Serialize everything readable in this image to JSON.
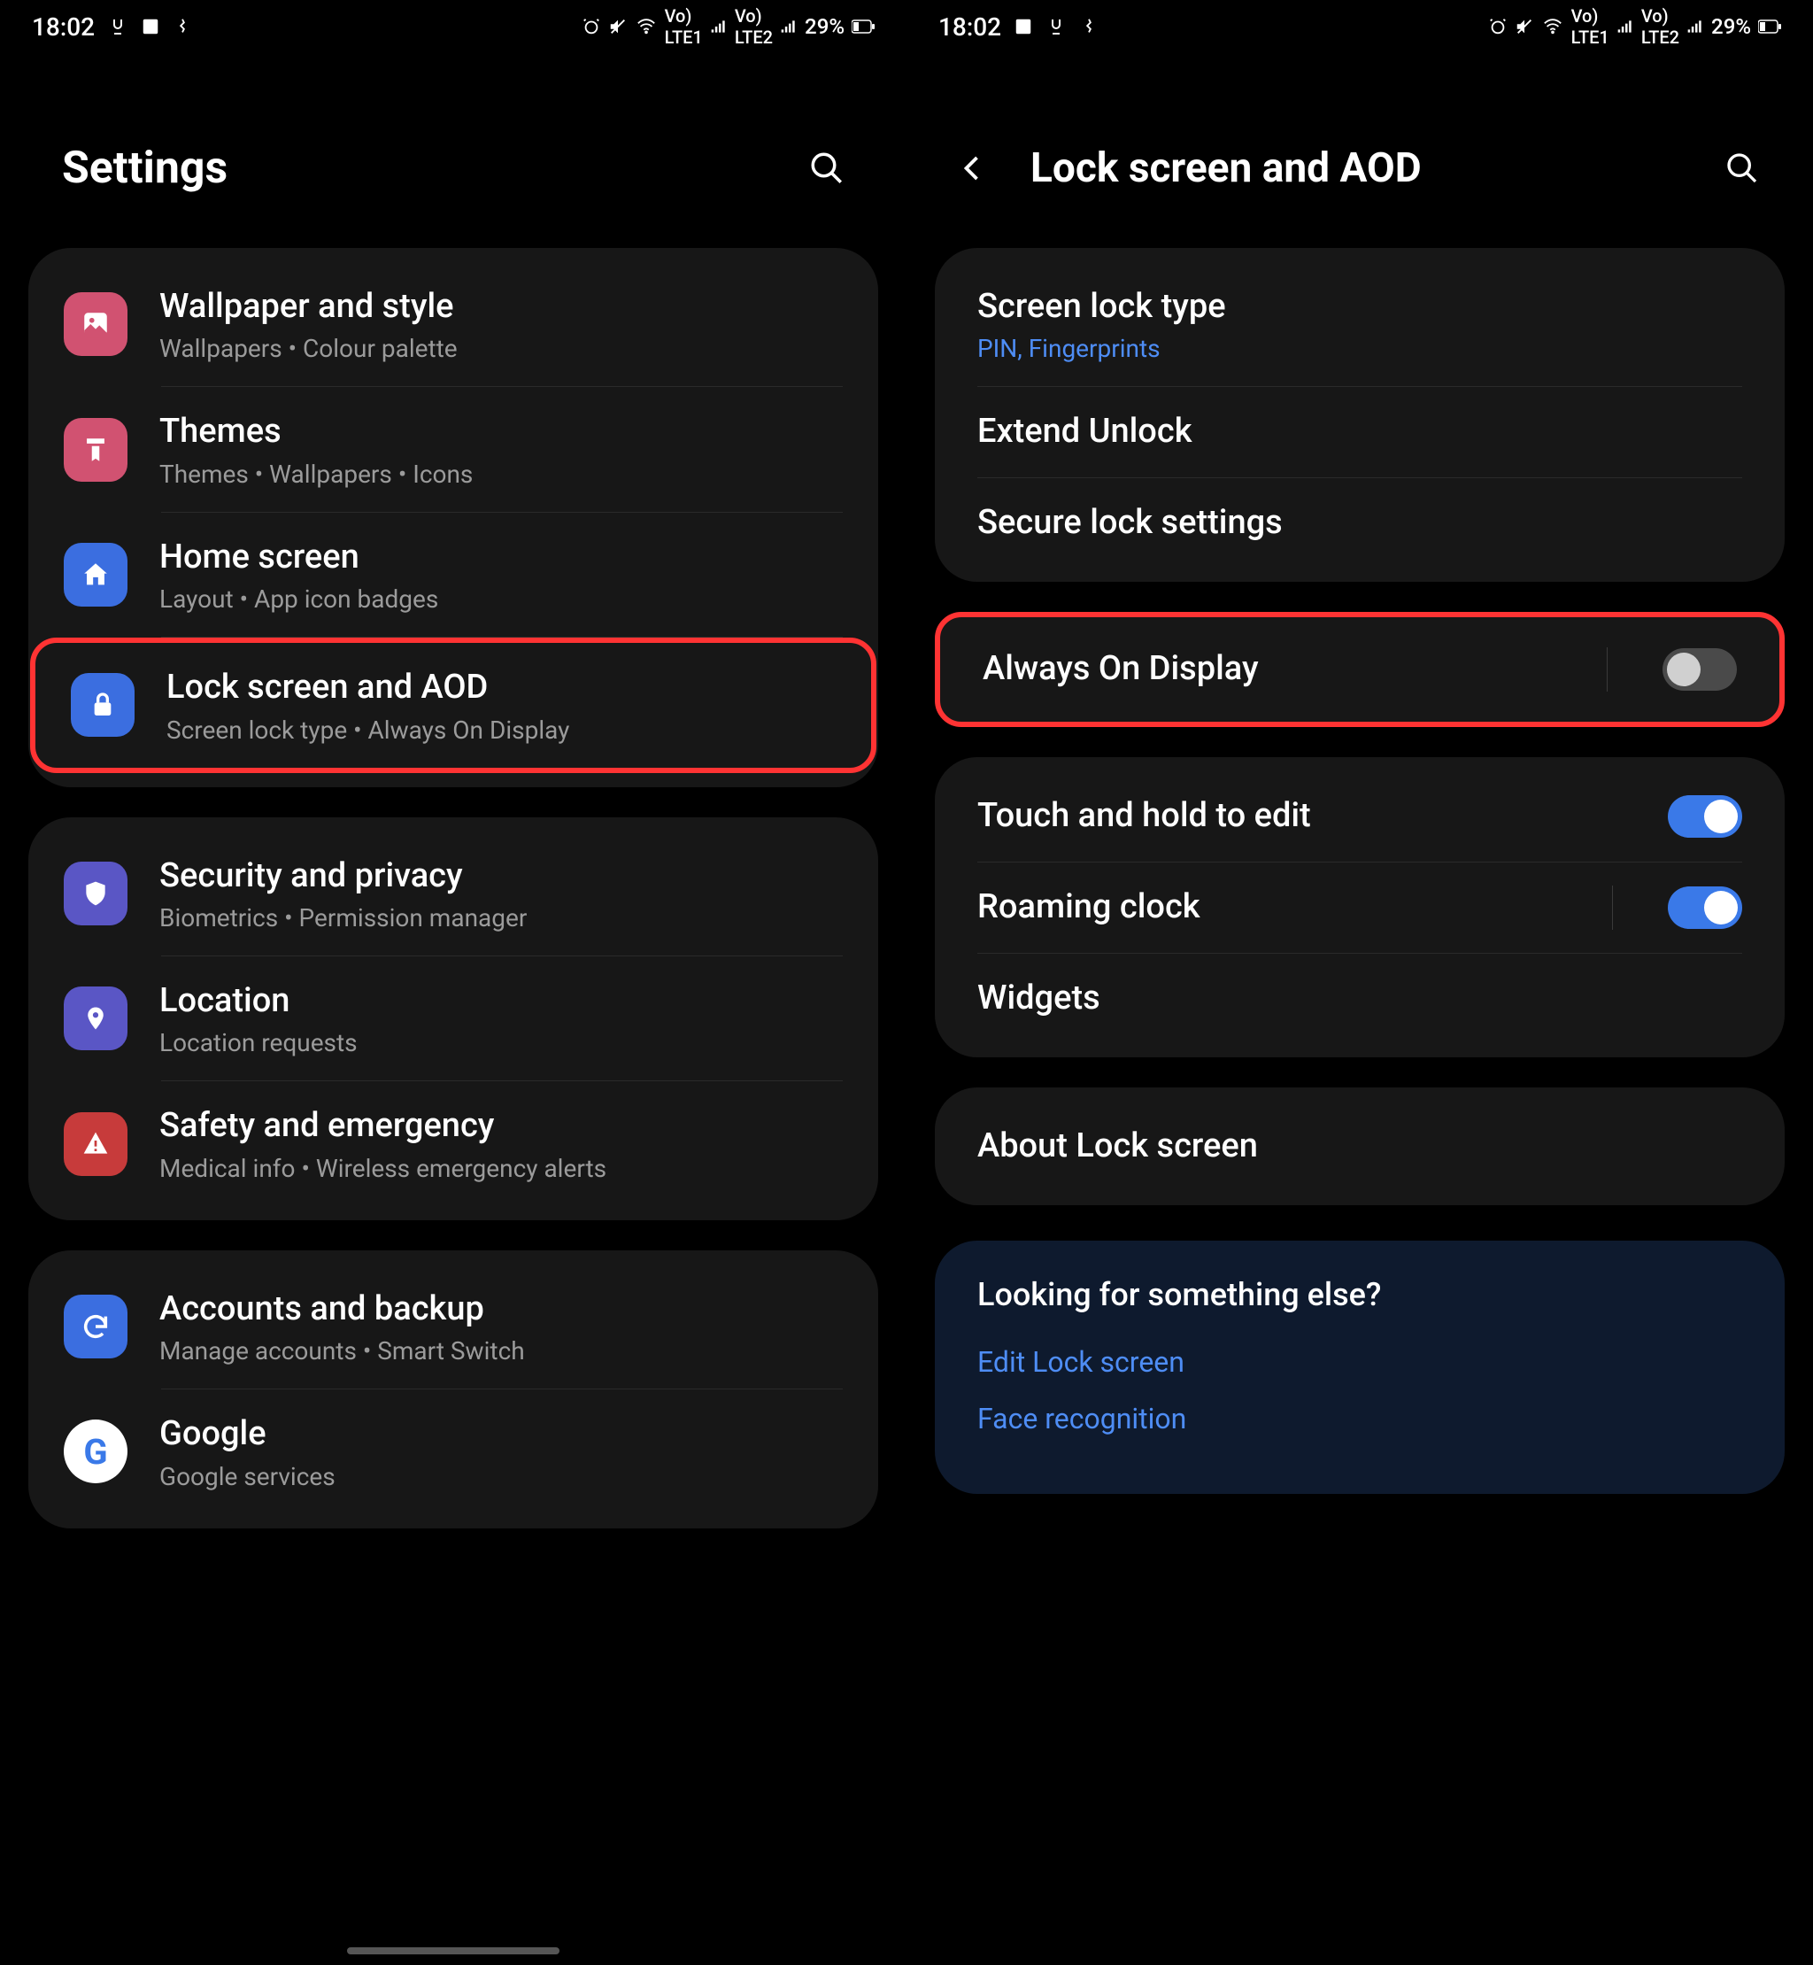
{
  "status": {
    "time": "18:02",
    "battery_pct": "29%"
  },
  "left": {
    "header": "Settings",
    "groups": [
      {
        "items": [
          {
            "icon": "wallpaper-icon",
            "color": "icon-pink",
            "title": "Wallpaper and style",
            "sub": "Wallpapers  •  Colour palette"
          },
          {
            "icon": "themes-icon",
            "color": "icon-pink",
            "title": "Themes",
            "sub": "Themes  •  Wallpapers  •  Icons"
          },
          {
            "icon": "home-icon",
            "color": "icon-blue",
            "title": "Home screen",
            "sub": "Layout  •  App icon badges"
          },
          {
            "icon": "lock-icon",
            "color": "icon-blue",
            "title": "Lock screen and AOD",
            "sub": "Screen lock type  •  Always On Display",
            "highlight": true
          }
        ]
      },
      {
        "items": [
          {
            "icon": "shield-icon",
            "color": "icon-purple",
            "title": "Security and privacy",
            "sub": "Biometrics  •  Permission manager"
          },
          {
            "icon": "location-icon",
            "color": "icon-purple",
            "title": "Location",
            "sub": "Location requests"
          },
          {
            "icon": "alert-icon",
            "color": "icon-red",
            "title": "Safety and emergency",
            "sub": "Medical info  •  Wireless emergency alerts"
          }
        ]
      },
      {
        "items": [
          {
            "icon": "sync-icon",
            "color": "icon-blue",
            "title": "Accounts and backup",
            "sub": "Manage accounts  •  Smart Switch"
          },
          {
            "icon": "google-icon",
            "color": "icon-gcircle",
            "title": "Google",
            "sub": "Google services"
          }
        ]
      }
    ]
  },
  "right": {
    "header": "Lock screen and AOD",
    "groups": [
      {
        "items": [
          {
            "title": "Screen lock type",
            "sub": "PIN, Fingerprints",
            "sub_blue": true
          },
          {
            "title": "Extend Unlock"
          },
          {
            "title": "Secure lock settings"
          }
        ]
      },
      {
        "highlight": true,
        "items": [
          {
            "title": "Always On Display",
            "toggle": "off",
            "vsep": true
          }
        ]
      },
      {
        "items": [
          {
            "title": "Touch and hold to edit",
            "toggle": "on"
          },
          {
            "title": "Roaming clock",
            "toggle": "on",
            "vsep": true
          },
          {
            "title": "Widgets"
          }
        ]
      },
      {
        "items": [
          {
            "title": "About Lock screen"
          }
        ]
      }
    ],
    "footer": {
      "title": "Looking for something else?",
      "links": [
        "Edit Lock screen",
        "Face recognition"
      ]
    }
  }
}
